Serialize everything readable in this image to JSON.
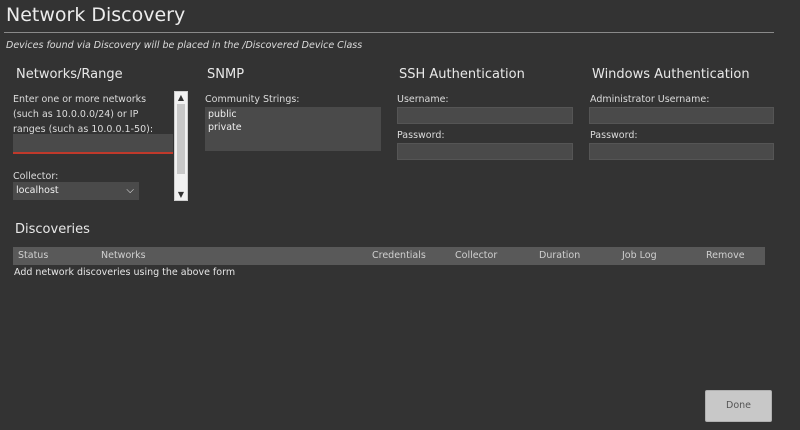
{
  "dialog": {
    "title": "Network Discovery",
    "subtitle": "Devices found via Discovery will be placed in the /Discovered Device Class",
    "done_label": "Done"
  },
  "networks": {
    "heading": "Networks/Range",
    "description": "Enter one or more networks (such as 10.0.0.0/24) or IP ranges (such as 10.0.0.1-50):",
    "input_value": "",
    "collector_label": "Collector:",
    "collector_value": "localhost"
  },
  "snmp": {
    "heading": "SNMP",
    "community_label": "Community Strings:",
    "community_values": [
      "public",
      "private"
    ]
  },
  "ssh": {
    "heading": "SSH Authentication",
    "username_label": "Username:",
    "password_label": "Password:"
  },
  "windows": {
    "heading": "Windows Authentication",
    "username_label": "Administrator Username:",
    "password_label": "Password:"
  },
  "discoveries": {
    "heading": "Discoveries",
    "columns": [
      "Status",
      "Networks",
      "Credentials",
      "Collector",
      "Duration",
      "Job Log",
      "Remove"
    ],
    "empty_message": "Add network discoveries using the above form"
  },
  "colors": {
    "background": "#333333",
    "field": "#4a4a4a",
    "invalid_underline": "#c0392b",
    "table_header": "#595959"
  },
  "icons": {
    "collector_dropdown": "chevron-down-icon",
    "scroll_up": "scroll-up-arrow-icon",
    "scroll_down": "scroll-down-arrow-icon"
  }
}
